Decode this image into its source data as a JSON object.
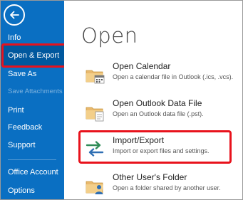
{
  "sidebar": {
    "items": [
      {
        "label": "Info"
      },
      {
        "label": "Open & Export"
      },
      {
        "label": "Save As"
      },
      {
        "label": "Save Attachments"
      },
      {
        "label": "Print"
      },
      {
        "label": "Feedback"
      },
      {
        "label": "Support"
      },
      {
        "label": "Office Account"
      },
      {
        "label": "Options"
      }
    ]
  },
  "main": {
    "title": "Open",
    "options": [
      {
        "title": "Open Calendar",
        "description": "Open a calendar file in Outlook (.ics, .vcs)."
      },
      {
        "title": "Open Outlook Data File",
        "description": "Open an Outlook data file (.pst)."
      },
      {
        "title": "Import/Export",
        "description": "Import or export files and settings."
      },
      {
        "title": "Other User's Folder",
        "description": "Open a folder shared by another user."
      }
    ]
  },
  "colors": {
    "sidebar": "#0a6fc2",
    "sidebar_selected": "#00589e",
    "highlight": "#e8121c"
  },
  "icons": {
    "back": "back-arrow-icon",
    "calendar": "folder-calendar-icon",
    "data_file": "folder-file-icon",
    "import_export": "import-export-arrows-icon",
    "user_folder": "folder-user-icon"
  }
}
